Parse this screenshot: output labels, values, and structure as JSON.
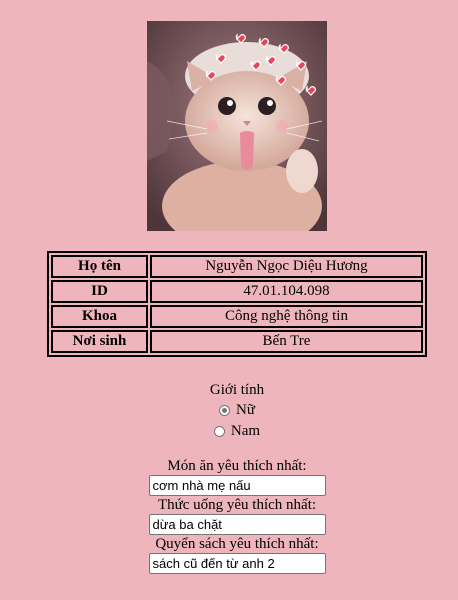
{
  "profile": {
    "photo_icon": "cat-with-heart-filter-photo"
  },
  "info": {
    "rows": [
      {
        "key": "Họ tên",
        "value": "Nguyễn Ngọc Diệu Hương"
      },
      {
        "key": "ID",
        "value": "47.01.104.098"
      },
      {
        "key": "Khoa",
        "value": "Công nghệ thông tin"
      },
      {
        "key": "Nơi sinh",
        "value": "Bến Tre"
      }
    ]
  },
  "gender": {
    "title": "Giới tính",
    "options": [
      {
        "label": "Nữ",
        "checked": true
      },
      {
        "label": "Nam",
        "checked": false
      }
    ]
  },
  "favorites": {
    "food_label": "Món ăn yêu thích nhất:",
    "food_value": "cơm nhà mẹ nấu",
    "drink_label": "Thức uống yêu thích nhất:",
    "drink_value": "dừa ba chặt",
    "book_label": "Quyển sách yêu thích nhất:",
    "book_value": "sách cũ đến từ anh 2"
  },
  "colors": {
    "background": "#efb5bd"
  }
}
